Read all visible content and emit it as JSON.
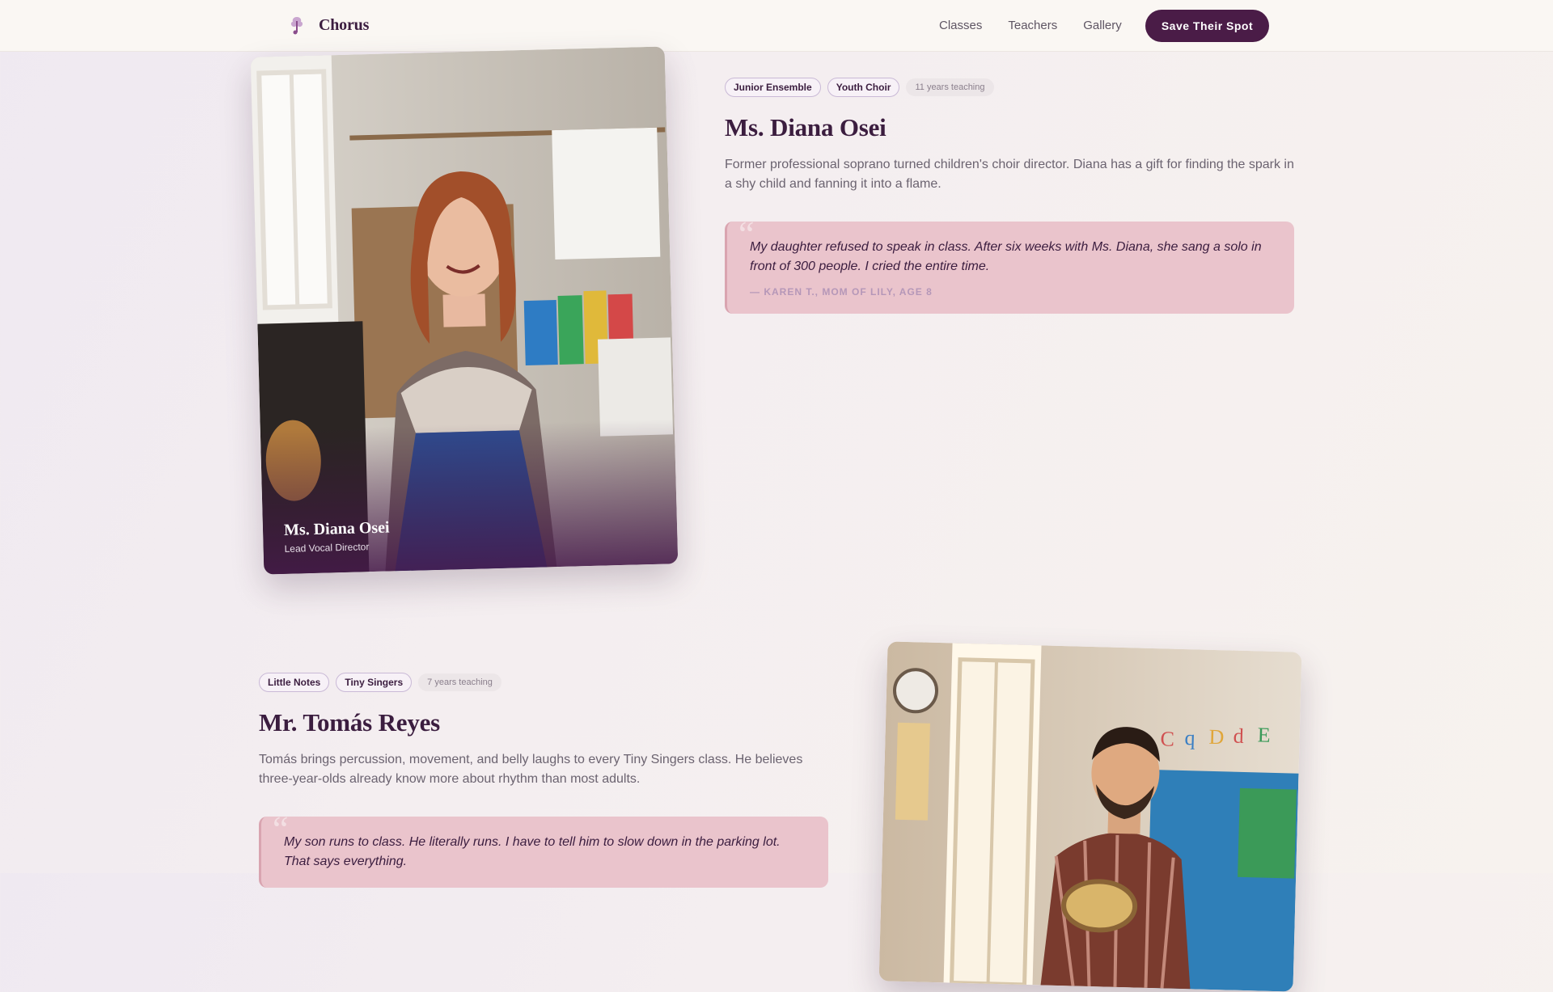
{
  "nav": {
    "brand": "Chorus",
    "links": [
      "Classes",
      "Teachers",
      "Gallery"
    ],
    "cta": "Save Their Spot"
  },
  "teachers": [
    {
      "name": "Ms. Diana Osei",
      "role": "Lead Vocal Director",
      "tags": [
        "Junior Ensemble",
        "Youth Choir"
      ],
      "years": "11 years teaching",
      "bio": "Former professional soprano turned children's choir director. Diana has a gift for finding the spark in a shy child and fanning it into a flame.",
      "quote": "My daughter refused to speak in class. After six weeks with Ms. Diana, she sang a solo in front of 300 people. I cried the entire time.",
      "quote_attr": "— KAREN T., MOM OF LILY, AGE 8"
    },
    {
      "name": "Mr. Tomás Reyes",
      "tags": [
        "Little Notes",
        "Tiny Singers"
      ],
      "years": "7 years teaching",
      "bio": "Tomás brings percussion, movement, and belly laughs to every Tiny Singers class. He believes three-year-olds already know more about rhythm than most adults.",
      "quote": "My son runs to class. He literally runs. I have to tell him to slow down in the parking lot. That says everything."
    }
  ],
  "quote_mark": "“",
  "colors": {
    "accent": "#4a1c47",
    "quote_bg": "#eac4cc",
    "text": "#3b1d3f"
  }
}
